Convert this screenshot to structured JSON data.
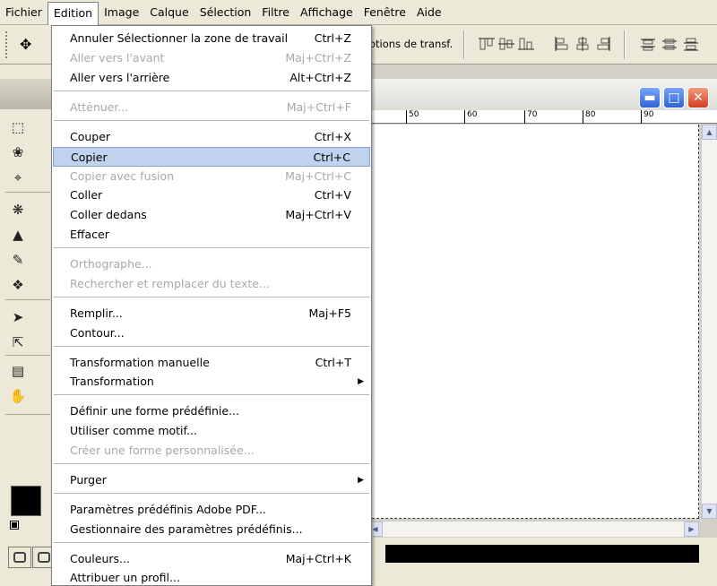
{
  "menubar": {
    "items": [
      "Fichier",
      "Edition",
      "Image",
      "Calque",
      "Sélection",
      "Filtre",
      "Affichage",
      "Fenêtre",
      "Aide"
    ]
  },
  "options_bar": {
    "transform_label": "otions de transf."
  },
  "ruler": {
    "ticks": [
      "50",
      "60",
      "70",
      "80",
      "90"
    ]
  },
  "edit_menu": {
    "items": [
      {
        "label": "Annuler Sélectionner la zone de travail",
        "shortcut": "Ctrl+Z",
        "enabled": true
      },
      {
        "label": "Aller vers l'avant",
        "shortcut": "Maj+Ctrl+Z",
        "enabled": false
      },
      {
        "label": "Aller vers l'arrière",
        "shortcut": "Alt+Ctrl+Z",
        "enabled": true
      },
      {
        "label": "Atténuer...",
        "shortcut": "Maj+Ctrl+F",
        "enabled": false
      },
      {
        "label": "Couper",
        "shortcut": "Ctrl+X",
        "enabled": true
      },
      {
        "label": "Copier",
        "shortcut": "Ctrl+C",
        "enabled": true,
        "highlighted": true
      },
      {
        "label": "Copier avec fusion",
        "shortcut": "Maj+Ctrl+C",
        "enabled": false
      },
      {
        "label": "Coller",
        "shortcut": "Ctrl+V",
        "enabled": true
      },
      {
        "label": "Coller dedans",
        "shortcut": "Maj+Ctrl+V",
        "enabled": true
      },
      {
        "label": "Effacer",
        "shortcut": "",
        "enabled": true
      },
      {
        "label": "Orthographe...",
        "shortcut": "",
        "enabled": false
      },
      {
        "label": "Rechercher et remplacer du texte...",
        "shortcut": "",
        "enabled": false
      },
      {
        "label": "Remplir...",
        "shortcut": "Maj+F5",
        "enabled": true
      },
      {
        "label": "Contour...",
        "shortcut": "",
        "enabled": true
      },
      {
        "label": "Transformation manuelle",
        "shortcut": "Ctrl+T",
        "enabled": true
      },
      {
        "label": "Transformation",
        "shortcut": "",
        "enabled": true,
        "submenu": true
      },
      {
        "label": "Définir une forme prédéfinie...",
        "shortcut": "",
        "enabled": true
      },
      {
        "label": "Utiliser comme motif...",
        "shortcut": "",
        "enabled": true
      },
      {
        "label": "Créer une forme personnalisée...",
        "shortcut": "",
        "enabled": false
      },
      {
        "label": "Purger",
        "shortcut": "",
        "enabled": true,
        "submenu": true
      },
      {
        "label": "Paramètres prédéfinis Adobe PDF...",
        "shortcut": "",
        "enabled": true
      },
      {
        "label": "Gestionnaire des paramètres prédéfinis...",
        "shortcut": "",
        "enabled": true
      },
      {
        "label": "Couleurs...",
        "shortcut": "Maj+Ctrl+K",
        "enabled": true
      },
      {
        "label": "Attribuer un profil...",
        "shortcut": "",
        "enabled": true
      }
    ]
  },
  "colors": {
    "menu_highlight": "#c1d2ee",
    "disabled_text": "#a8a8a8",
    "close_button": "#d1401f",
    "title_buttons": "#2f63d8"
  }
}
